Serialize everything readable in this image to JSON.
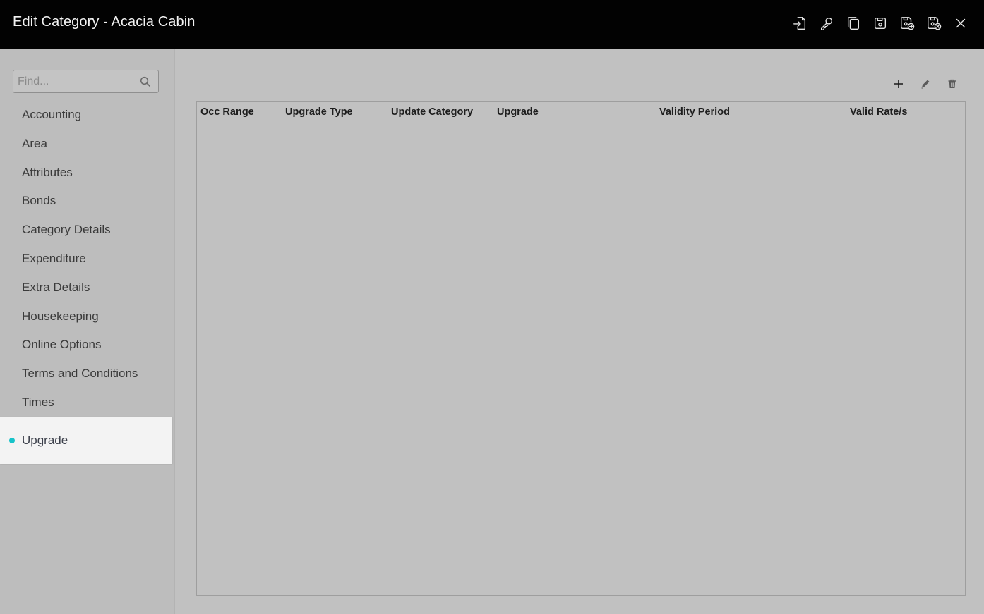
{
  "window": {
    "title": "Edit Category - Acacia Cabin",
    "actions": [
      {
        "name": "export-icon"
      },
      {
        "name": "key-icon"
      },
      {
        "name": "copy-icon"
      },
      {
        "name": "save-icon"
      },
      {
        "name": "save-and-new-icon"
      },
      {
        "name": "save-and-close-icon"
      },
      {
        "name": "close-icon"
      }
    ]
  },
  "sidebar": {
    "search": {
      "placeholder": "Find...",
      "value": ""
    },
    "items": [
      {
        "label": "Accounting"
      },
      {
        "label": "Area"
      },
      {
        "label": "Attributes"
      },
      {
        "label": "Bonds"
      },
      {
        "label": "Category Details"
      },
      {
        "label": "Expenditure"
      },
      {
        "label": "Extra Details"
      },
      {
        "label": "Housekeeping"
      },
      {
        "label": "Online Options"
      },
      {
        "label": "Terms and Conditions"
      },
      {
        "label": "Times"
      },
      {
        "label": "Upgrade",
        "active": true
      }
    ],
    "active_color": "#17c3c9"
  },
  "toolbar": {
    "buttons": [
      {
        "name": "add-icon"
      },
      {
        "name": "edit-icon"
      },
      {
        "name": "delete-icon"
      }
    ]
  },
  "grid": {
    "columns": [
      "Occ Range",
      "Upgrade Type",
      "Update Category",
      "Upgrade",
      "Validity Period",
      "Valid Rate/s"
    ],
    "rows": []
  }
}
